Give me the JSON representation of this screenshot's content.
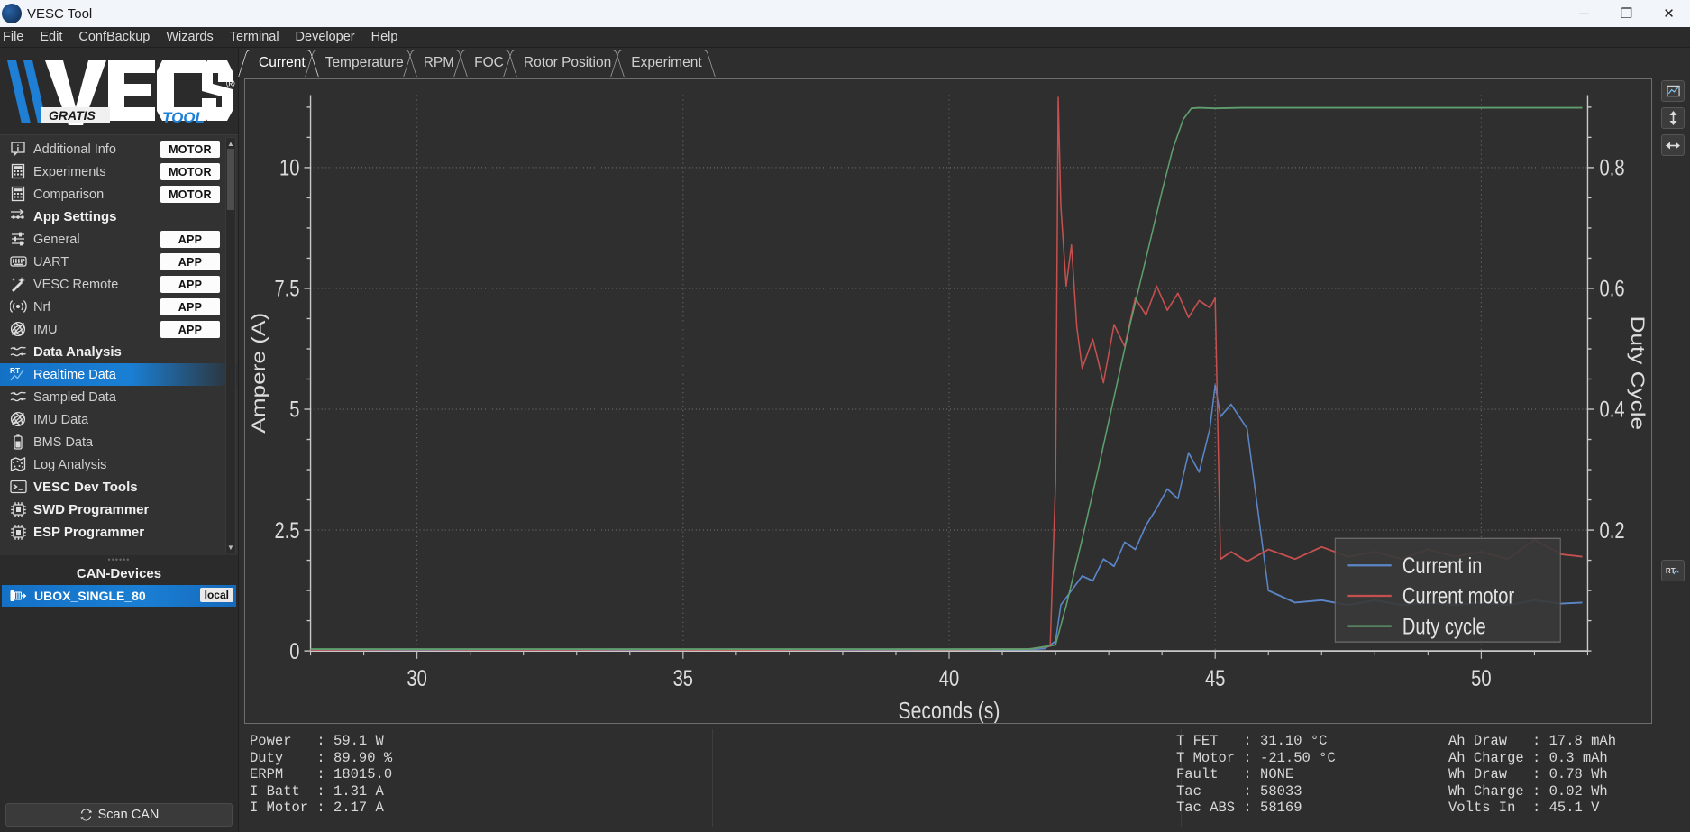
{
  "window": {
    "title": "VESC Tool",
    "icon": "vesc-logo-icon",
    "minimize": "─",
    "maximize": "❐",
    "close": "✕"
  },
  "menubar": {
    "items": [
      {
        "label": "File"
      },
      {
        "label": "Edit"
      },
      {
        "label": "ConfBackup"
      },
      {
        "label": "Wizards"
      },
      {
        "label": "Terminal"
      },
      {
        "label": "Developer"
      },
      {
        "label": "Help"
      }
    ]
  },
  "logo": {
    "wordmark": "VESC",
    "registered": "®",
    "gratis": "GRATIS",
    "tool": "TOOL"
  },
  "sidebar": {
    "items": [
      {
        "label": "Additional Info",
        "icon": "info-bubble-icon",
        "badge": "MOTOR",
        "selected": false,
        "section": false
      },
      {
        "label": "Experiments",
        "icon": "grid-calc-icon",
        "badge": "MOTOR",
        "selected": false,
        "section": false
      },
      {
        "label": "Comparison",
        "icon": "grid-calc-icon",
        "badge": "MOTOR",
        "selected": false,
        "section": false
      },
      {
        "label": "App Settings",
        "icon": "sliders-arrow-icon",
        "badge": "",
        "selected": false,
        "section": true
      },
      {
        "label": "General",
        "icon": "sliders-icon",
        "badge": "APP",
        "selected": false,
        "section": false
      },
      {
        "label": "UART",
        "icon": "keyboard-icon",
        "badge": "APP",
        "selected": false,
        "section": false
      },
      {
        "label": "VESC Remote",
        "icon": "wand-icon",
        "badge": "APP",
        "selected": false,
        "section": false
      },
      {
        "label": "Nrf",
        "icon": "wireless-icon",
        "badge": "APP",
        "selected": false,
        "section": false
      },
      {
        "label": "IMU",
        "icon": "gyro-icon",
        "badge": "APP",
        "selected": false,
        "section": false
      },
      {
        "label": "Data Analysis",
        "icon": "waves-icon",
        "badge": "",
        "selected": false,
        "section": true
      },
      {
        "label": "Realtime Data",
        "icon": "rt-chart-icon",
        "badge": "",
        "selected": true,
        "section": false
      },
      {
        "label": "Sampled Data",
        "icon": "waves-icon",
        "badge": "",
        "selected": false,
        "section": false
      },
      {
        "label": "IMU Data",
        "icon": "gyro-icon",
        "badge": "",
        "selected": false,
        "section": false
      },
      {
        "label": "BMS Data",
        "icon": "battery-icon",
        "badge": "",
        "selected": false,
        "section": false
      },
      {
        "label": "Log Analysis",
        "icon": "map-icon",
        "badge": "",
        "selected": false,
        "section": false
      },
      {
        "label": "VESC Dev Tools",
        "icon": "terminal-icon",
        "badge": "",
        "selected": false,
        "section": true
      },
      {
        "label": "SWD Programmer",
        "icon": "chip-icon",
        "badge": "",
        "selected": false,
        "section": true
      },
      {
        "label": "ESP Programmer",
        "icon": "chip-icon",
        "badge": "",
        "selected": false,
        "section": true
      }
    ]
  },
  "can": {
    "header": "CAN-Devices",
    "devices": [
      {
        "name": "UBOX_SINGLE_80",
        "tag": "local",
        "icon": "motor-controller-icon"
      }
    ],
    "scan_label": "Scan CAN",
    "scan_icon": "refresh-icon"
  },
  "tabs": [
    {
      "label": "Current",
      "active": true
    },
    {
      "label": "Temperature",
      "active": false
    },
    {
      "label": "RPM",
      "active": false
    },
    {
      "label": "FOC",
      "active": false
    },
    {
      "label": "Rotor Position",
      "active": false
    },
    {
      "label": "Experiment",
      "active": false
    }
  ],
  "right_toolbar": [
    {
      "icon": "chart-window-icon"
    },
    {
      "icon": "vertical-zoom-icon"
    },
    {
      "icon": "horizontal-zoom-icon"
    },
    {
      "icon": "realtime-toggle-icon"
    }
  ],
  "chart_data": {
    "type": "line",
    "title": "",
    "xlabel": "Seconds (s)",
    "ylabel": "Ampere (A)",
    "y2label": "Duty Cycle",
    "xlim": [
      28.0,
      52.0
    ],
    "ylim": [
      0,
      11.5
    ],
    "y2lim": [
      0,
      0.92
    ],
    "xticks": [
      30,
      35,
      40,
      45,
      50
    ],
    "yticks": [
      0,
      2.5,
      5,
      7.5,
      10
    ],
    "y2ticks": [
      0.2,
      0.4,
      0.6,
      0.8
    ],
    "grid": true,
    "legend_position": "bottom-right",
    "colors": {
      "current_in": "#5b86c8",
      "current_motor": "#c5504f",
      "duty_cycle": "#5f9e6e",
      "background": "#2f2f2f",
      "axis": "#c8c8c8",
      "grid": "#6a6a6a"
    },
    "series": [
      {
        "name": "Current in",
        "axis": "left",
        "color": "#5b86c8",
        "x": [
          28.0,
          30.0,
          32.0,
          34.0,
          36.0,
          38.0,
          40.0,
          41.5,
          41.8,
          42.0,
          42.1,
          42.3,
          42.5,
          42.7,
          42.9,
          43.1,
          43.3,
          43.5,
          43.7,
          43.9,
          44.1,
          44.3,
          44.5,
          44.7,
          44.9,
          45.0,
          45.1,
          45.3,
          45.6,
          46.0,
          46.5,
          47.0,
          47.5,
          48.0,
          48.5,
          49.0,
          49.5,
          50.0,
          50.5,
          51.0,
          51.5,
          51.9
        ],
        "y": [
          0.02,
          0.02,
          0.02,
          0.02,
          0.03,
          0.02,
          0.03,
          0.03,
          0.05,
          0.2,
          0.95,
          1.25,
          1.55,
          1.45,
          1.9,
          1.75,
          2.25,
          2.1,
          2.6,
          2.95,
          3.35,
          3.15,
          4.1,
          3.7,
          4.6,
          5.5,
          4.85,
          5.1,
          4.6,
          1.25,
          1.0,
          1.05,
          0.95,
          1.05,
          0.95,
          1.0,
          0.95,
          1.0,
          0.95,
          1.05,
          0.98,
          1.0
        ]
      },
      {
        "name": "Current motor",
        "axis": "left",
        "color": "#c5504f",
        "x": [
          28.0,
          30.0,
          32.0,
          34.0,
          36.0,
          38.0,
          40.0,
          41.5,
          41.9,
          42.0,
          42.05,
          42.1,
          42.2,
          42.3,
          42.4,
          42.5,
          42.7,
          42.9,
          43.1,
          43.3,
          43.5,
          43.7,
          43.9,
          44.1,
          44.3,
          44.5,
          44.7,
          44.9,
          45.0,
          45.1,
          45.3,
          45.6,
          46.0,
          46.5,
          47.0,
          47.5,
          48.0,
          48.5,
          49.0,
          49.5,
          50.0,
          50.5,
          51.0,
          51.5,
          51.9
        ],
        "y": [
          0.02,
          0.03,
          0.02,
          0.03,
          0.02,
          0.03,
          0.03,
          0.04,
          0.1,
          3.5,
          11.45,
          9.2,
          7.55,
          8.4,
          6.7,
          5.85,
          6.45,
          5.55,
          6.75,
          6.3,
          7.3,
          6.95,
          7.55,
          7.05,
          7.4,
          6.9,
          7.25,
          7.1,
          7.3,
          1.9,
          2.05,
          1.85,
          2.1,
          1.9,
          2.15,
          1.95,
          2.05,
          1.9,
          2.1,
          1.95,
          2.05,
          1.9,
          2.3,
          2.0,
          1.95
        ]
      },
      {
        "name": "Duty cycle",
        "axis": "right",
        "color": "#5f9e6e",
        "x": [
          28.0,
          30.0,
          32.0,
          34.0,
          36.0,
          38.0,
          40.0,
          41.5,
          42.0,
          42.2,
          42.5,
          42.8,
          43.1,
          43.4,
          43.7,
          44.0,
          44.2,
          44.4,
          44.55,
          44.7,
          45.0,
          45.5,
          46.0,
          47.0,
          48.0,
          49.0,
          50.0,
          51.0,
          51.9
        ],
        "y": [
          0.003,
          0.003,
          0.003,
          0.003,
          0.003,
          0.003,
          0.003,
          0.003,
          0.01,
          0.075,
          0.185,
          0.3,
          0.42,
          0.54,
          0.65,
          0.76,
          0.83,
          0.88,
          0.898,
          0.899,
          0.898,
          0.899,
          0.899,
          0.899,
          0.899,
          0.899,
          0.899,
          0.899,
          0.899
        ]
      }
    ]
  },
  "status": {
    "col1": [
      {
        "key": "Power  ",
        "value": "59.1 W"
      },
      {
        "key": "Duty   ",
        "value": "89.90 %"
      },
      {
        "key": "ERPM   ",
        "value": "18015.0"
      },
      {
        "key": "I Batt ",
        "value": "1.31 A"
      },
      {
        "key": "I Motor",
        "value": "2.17 A"
      }
    ],
    "col2": [
      {
        "key": "T FET  ",
        "value": "31.10 °C"
      },
      {
        "key": "T Motor",
        "value": "-21.50 °C"
      },
      {
        "key": "Fault  ",
        "value": "NONE"
      },
      {
        "key": "Tac    ",
        "value": "58033"
      },
      {
        "key": "Tac ABS",
        "value": "58169"
      }
    ],
    "col3": [
      {
        "key": "Ah Draw  ",
        "value": "17.8 mAh"
      },
      {
        "key": "Ah Charge",
        "value": "0.3 mAh"
      },
      {
        "key": "Wh Draw  ",
        "value": "0.78 Wh"
      },
      {
        "key": "Wh Charge",
        "value": "0.02 Wh"
      },
      {
        "key": "Volts In ",
        "value": "45.1 V"
      }
    ]
  }
}
